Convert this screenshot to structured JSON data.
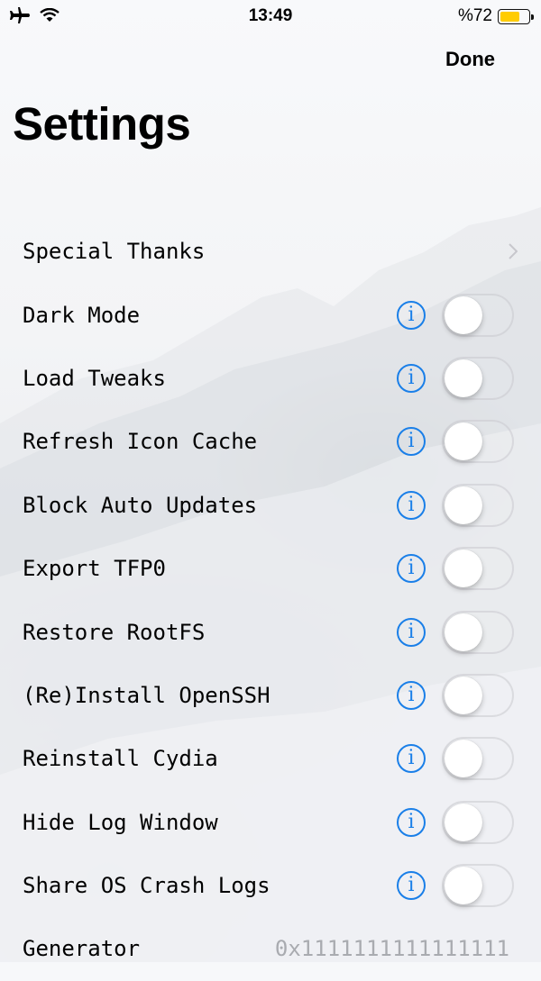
{
  "status_bar": {
    "time": "13:49",
    "battery_text": "%72",
    "battery_level": 0.72,
    "icons": [
      "airplane-icon",
      "wifi-icon",
      "battery-icon"
    ]
  },
  "nav": {
    "done_label": "Done",
    "title": "Settings"
  },
  "rows": [
    {
      "label": "Special Thanks",
      "accessory": "chevron"
    },
    {
      "label": "Dark Mode",
      "accessory": "toggle",
      "on": false
    },
    {
      "label": "Load Tweaks",
      "accessory": "toggle",
      "on": false
    },
    {
      "label": "Refresh Icon Cache",
      "accessory": "toggle",
      "on": false
    },
    {
      "label": "Block Auto Updates",
      "accessory": "toggle",
      "on": false
    },
    {
      "label": "Export TFP0",
      "accessory": "toggle",
      "on": false
    },
    {
      "label": "Restore RootFS",
      "accessory": "toggle",
      "on": false
    },
    {
      "label": "(Re)Install OpenSSH",
      "accessory": "toggle",
      "on": false
    },
    {
      "label": "Reinstall Cydia",
      "accessory": "toggle",
      "on": false
    },
    {
      "label": "Hide Log Window",
      "accessory": "toggle",
      "on": false
    },
    {
      "label": "Share OS Crash Logs",
      "accessory": "toggle",
      "on": false
    },
    {
      "label": "Generator",
      "accessory": "value",
      "value": "0x1111111111111111"
    }
  ],
  "info_glyph": "i",
  "colors": {
    "accent": "#1a7fe8",
    "battery": "#ffcc00",
    "value_text": "#a9abb0"
  }
}
